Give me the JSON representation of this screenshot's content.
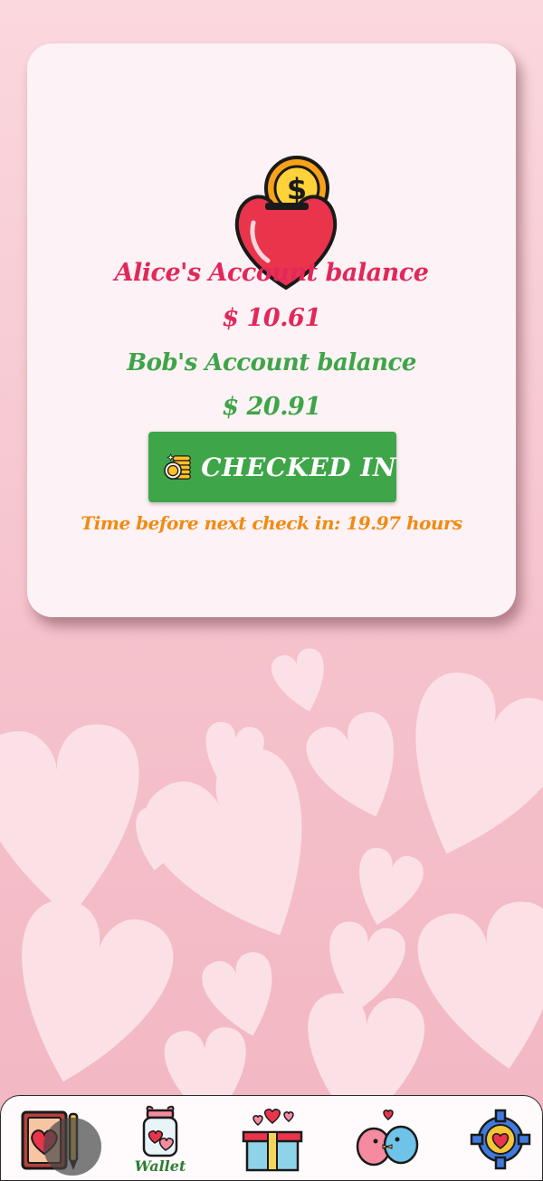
{
  "balances": {
    "alice_label": "Alice's Account balance",
    "alice_value": "$ 10.61",
    "bob_label": "Bob's Account balance",
    "bob_value": "$ 20.91"
  },
  "checkin": {
    "button_label": "CHECKED IN",
    "timer_text": "Time before next check in: 19.97 hours"
  },
  "nav": {
    "wallet_label": "Wallet",
    "items": [
      {
        "icon": "diary-book-icon"
      },
      {
        "icon": "heart-jar-wallet-icon"
      },
      {
        "icon": "gift-box-icon"
      },
      {
        "icon": "lovebirds-icon"
      },
      {
        "icon": "heart-gear-settings-icon"
      }
    ]
  },
  "colors": {
    "alice": "#e1285a",
    "bob": "#3ea548",
    "timer": "#f28a12",
    "button": "#3ea548",
    "card": "#fdf2f5",
    "background": "#f7c9d2"
  }
}
